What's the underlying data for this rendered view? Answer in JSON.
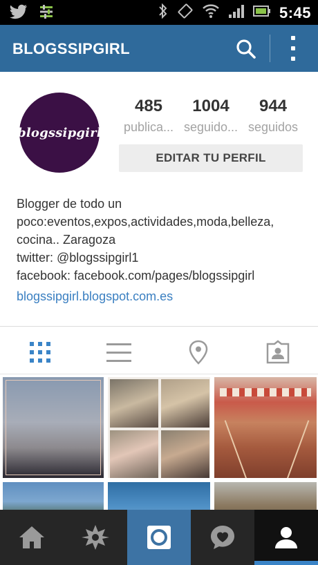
{
  "status_bar": {
    "time": "5:45",
    "icons": [
      "twitter-icon",
      "settings-sliders-icon",
      "bluetooth-icon",
      "vibrate-icon",
      "wifi-icon",
      "signal-icon",
      "battery-icon"
    ]
  },
  "app_bar": {
    "title": "BLOGSSIPGIRL",
    "search_icon": "search-icon",
    "more_icon": "more-vertical-icon"
  },
  "profile": {
    "avatar_text": "blogssipgirl",
    "avatar_color": "#3b1045",
    "stats": [
      {
        "value": "485",
        "label": "publica..."
      },
      {
        "value": "1004",
        "label": "seguido..."
      },
      {
        "value": "944",
        "label": "seguidos"
      }
    ],
    "edit_button": "EDITAR TU PERFIL",
    "bio_lines": [
      "Blogger de todo un",
      "poco:eventos,expos,actividades,moda,belleza,",
      "cocina.. Zaragoza",
      "twitter: @blogssipgirl1",
      "facebook: facebook.com/pages/blogssipgirl"
    ],
    "website": "blogssipgirl.blogspot.com.es"
  },
  "tabs": [
    {
      "name": "grid-view",
      "icon": "grid-icon",
      "active": true
    },
    {
      "name": "list-view",
      "icon": "list-icon",
      "active": false
    },
    {
      "name": "photo-map",
      "icon": "location-pin-icon",
      "active": false
    },
    {
      "name": "photos-of-you",
      "icon": "person-tag-icon",
      "active": false
    }
  ],
  "bottom_nav": [
    {
      "name": "home",
      "icon": "home-icon"
    },
    {
      "name": "explore",
      "icon": "explore-star-icon"
    },
    {
      "name": "camera",
      "icon": "camera-icon",
      "highlight": true
    },
    {
      "name": "activity",
      "icon": "heart-bubble-icon"
    },
    {
      "name": "profile",
      "icon": "person-icon",
      "selected": true
    }
  ],
  "colors": {
    "app_bar": "#2f6a9b",
    "link": "#3a7fc1",
    "camera_tab": "#3d73a4",
    "active_tab_icon": "#3a84c7"
  }
}
